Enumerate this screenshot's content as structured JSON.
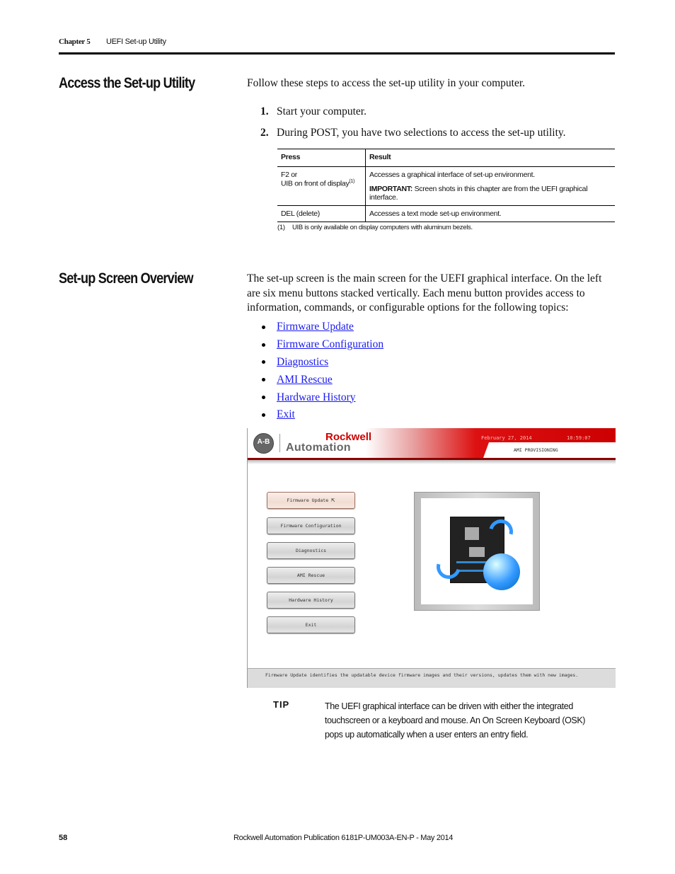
{
  "header": {
    "chapter": "Chapter 5",
    "title": "UEFI Set-up Utility"
  },
  "section1": {
    "title": "Access the Set-up Utility",
    "intro": "Follow these steps to access the set-up utility in your computer.",
    "steps": [
      {
        "num": "1.",
        "text": "Start your computer."
      },
      {
        "num": "2.",
        "text": "During POST, you have two selections to access the set-up utility."
      }
    ],
    "table": {
      "headers": [
        "Press",
        "Result"
      ],
      "rows": [
        {
          "press_line1": "F2 or",
          "press_line2": "UIB on front of display",
          "press_sup": "(1)",
          "result": "Accesses a graphical interface of set-up environment.",
          "important_label": "IMPORTANT:",
          "important_text": " Screen shots in this chapter are from the UEFI graphical interface."
        },
        {
          "press_line1": "DEL (delete)",
          "result": "Accesses a text mode set-up environment."
        }
      ]
    },
    "footnote": {
      "num": "(1)",
      "text": "UIB is only available on display computers with aluminum bezels."
    }
  },
  "section2": {
    "title": "Set-up Screen Overview",
    "intro": "The set-up screen is the main screen for the UEFI graphical interface. On the left are six menu buttons stacked vertically. Each menu button provides access to information, commands, or configurable options for the following topics:",
    "links": [
      "Firmware Update",
      "Firmware Configuration",
      "Diagnostics",
      "AMI Rescue",
      "Hardware History",
      "Exit"
    ]
  },
  "screenshot": {
    "logo": "A-B",
    "brand_line1": "Rockwell",
    "brand_line2": "Automation",
    "date": "February 27, 2014",
    "time": "10:59:07",
    "tab_label": "AMI PROVISIONING",
    "buttons": [
      "Firmware Update",
      "Firmware Configuration",
      "Diagnostics",
      "AMI Rescue",
      "Hardware History",
      "Exit"
    ],
    "active_button": "Firmware Update",
    "status_text": "Firmware Update identifies the updatable device firmware images and their versions, updates them with new images.",
    "colors": {
      "brand_red": "#cc0000",
      "status_bar": "#dcdcdc"
    }
  },
  "tip": {
    "label": "TIP",
    "text": "The UEFI graphical interface can be driven with either the integrated touchscreen or a keyboard and mouse. An On Screen Keyboard (OSK) pops up automatically when a user enters an entry field."
  },
  "footer": {
    "page_number": "58",
    "publication": "Rockwell Automation Publication 6181P-UM003A-EN-P - May 2014"
  }
}
